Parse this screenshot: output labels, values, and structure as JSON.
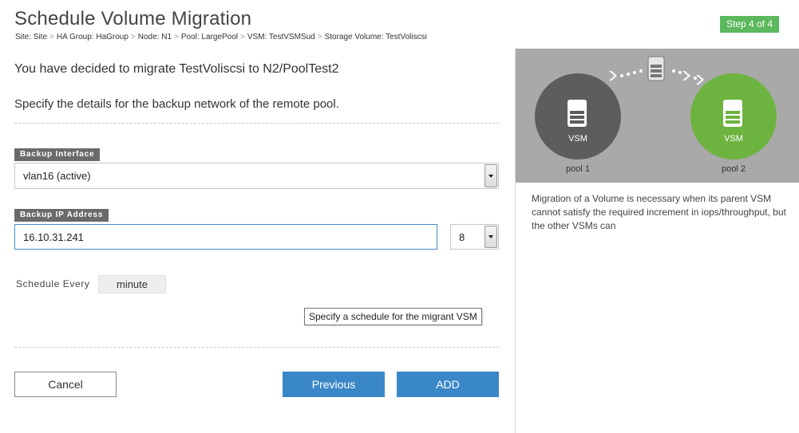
{
  "header": {
    "title": "Schedule Volume Migration",
    "step": "Step 4 of 4",
    "breadcrumb": [
      "Site: Site",
      "HA Group: HaGroup",
      "Node: N1",
      "Pool: LargePool",
      "VSM: TestVSMSud",
      "Storage Volume: TestVoliscsi"
    ],
    "breadcrumb_separator": ">"
  },
  "form": {
    "migrate_message": "You have decided to migrate TestVoliscsi to N2/PoolTest2",
    "instruction": "Specify the details for the backup network of the remote pool.",
    "backup_interface": {
      "label": "Backup Interface",
      "value": "vlan16 (active)"
    },
    "backup_ip": {
      "label": "Backup IP Address",
      "value": "16.10.31.241",
      "netmask": "8"
    },
    "schedule": {
      "label": "Schedule Every",
      "value": "minute",
      "tooltip": "Specify a schedule for the migrant VSM"
    }
  },
  "buttons": {
    "cancel": "Cancel",
    "previous": "Previous",
    "add": "ADD"
  },
  "diagram": {
    "source": {
      "vsm": "VSM",
      "pool": "pool 1",
      "color": "#5d5d5d"
    },
    "target": {
      "vsm": "VSM",
      "pool": "pool 2",
      "color": "#6db33f"
    },
    "background": "#a9a9a9",
    "moving_icon": "server-icon"
  },
  "info": {
    "description": "Migration of a Volume is necessary when its parent VSM cannot satisfy the required increment in iops/throughput, but the other VSMs can"
  },
  "colors": {
    "primary_button": "#3a87c8",
    "step_badge": "#5cb85c"
  }
}
